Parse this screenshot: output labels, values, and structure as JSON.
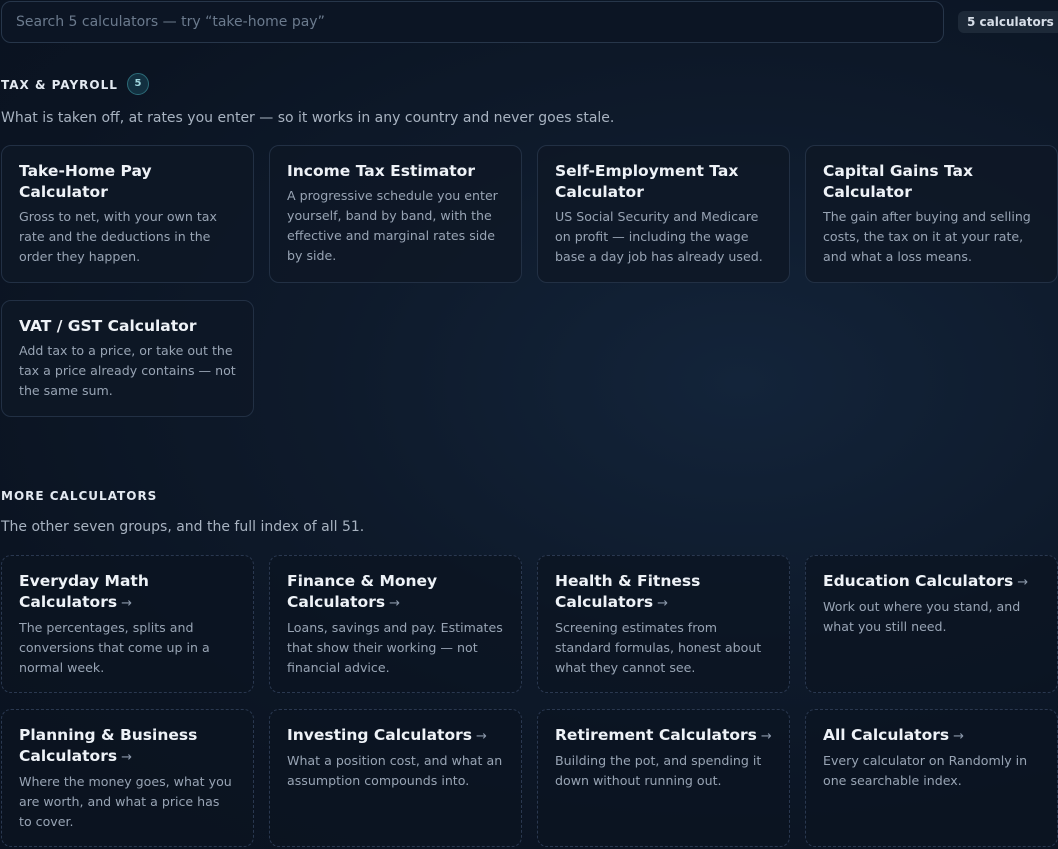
{
  "search": {
    "placeholder": "Search 5 calculators — try “take-home pay”",
    "count_label": "5 calculators"
  },
  "tax_section": {
    "heading": "TAX & PAYROLL",
    "count": "5",
    "description": "What is taken off, at rates you enter — so it works in any country and never goes stale.",
    "cards": [
      {
        "title": "Take-Home Pay Calculator",
        "description": "Gross to net, with your own tax rate and the deductions in the order they happen."
      },
      {
        "title": "Income Tax Estimator",
        "description": "A progressive schedule you enter yourself, band by band, with the effective and marginal rates side by side."
      },
      {
        "title": "Self-Employment Tax Calculator",
        "description": "US Social Security and Medicare on profit — including the wage base a day job has already used."
      },
      {
        "title": "Capital Gains Tax Calculator",
        "description": "The gain after buying and selling costs, the tax on it at your rate, and what a loss means."
      },
      {
        "title": "VAT / GST Calculator",
        "description": "Add tax to a price, or take out the tax a price already contains — not the same sum."
      }
    ]
  },
  "more_section": {
    "heading": "MORE CALCULATORS",
    "description": "The other seven groups, and the full index of all 51.",
    "arrow": "→",
    "cards": [
      {
        "title": "Everyday Math Calculators",
        "description": "The percentages, splits and conversions that come up in a normal week."
      },
      {
        "title": "Finance & Money Calculators",
        "description": "Loans, savings and pay. Estimates that show their working — not financial advice."
      },
      {
        "title": "Health & Fitness Calculators",
        "description": "Screening estimates from standard formulas, honest about what they cannot see."
      },
      {
        "title": "Education Calculators",
        "description": "Work out where you stand, and what you still need."
      },
      {
        "title": "Planning & Business Calculators",
        "description": "Where the money goes, what you are worth, and what a price has to cover."
      },
      {
        "title": "Investing Calculators",
        "description": "What a position cost, and what an assumption compounds into."
      },
      {
        "title": "Retirement Calculators",
        "description": "Building the pot, and spending it down without running out."
      },
      {
        "title": "All Calculators",
        "description": "Every calculator on Randomly in one searchable index."
      }
    ]
  }
}
